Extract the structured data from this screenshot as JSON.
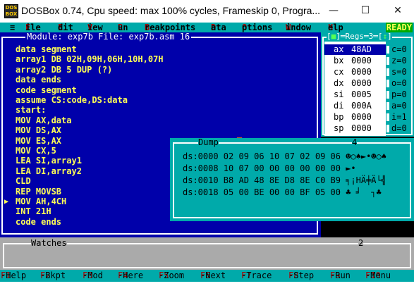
{
  "window": {
    "icon_text": "DOS\nBOX",
    "title": "DOSBox 0.74, Cpu speed: max 100% cycles, Frameskip  0, Progra...",
    "minimize": "—",
    "maximize": "☐",
    "close": "✕"
  },
  "menu": {
    "system": "≡",
    "items": [
      {
        "hot": "F",
        "rest": "ile"
      },
      {
        "hot": "E",
        "rest": "dit"
      },
      {
        "hot": "V",
        "rest": "iew"
      },
      {
        "hot": "R",
        "rest": "un"
      },
      {
        "hot": "B",
        "rest": "reakpoints"
      },
      {
        "hot": "D",
        "rest": "ata"
      },
      {
        "hot": "O",
        "rest": "ptions"
      },
      {
        "hot": "W",
        "rest": "indow"
      },
      {
        "hot": "H",
        "rest": "elp"
      }
    ],
    "status": "READY"
  },
  "module": {
    "title": "Module: exp7b File: exp7b.asm 16",
    "lines": [
      "data segment",
      "array1 DB 02H,09H,06H,10H,07H",
      "array2 DB 5 DUP (?)",
      "data ends",
      "code segment",
      "assume CS:code,DS:data",
      "start:",
      "MOV AX,data",
      "MOV DS,AX",
      "MOV ES,AX",
      "MOV CX,5",
      "LEA SI,array1",
      "LEA DI,array2",
      "CLD",
      "REP MOVSB",
      "MOV AH,4CH",
      "INT 21H",
      "code ends"
    ],
    "current_marker": "▶"
  },
  "regs": {
    "title_left": "[",
    "title_dot": "■",
    "title_mid": "]═Regs═3═[",
    "title_arrow": "↕",
    "title_right": "]",
    "rows": [
      {
        "name": "ax",
        "value": "48AD"
      },
      {
        "name": "bx",
        "value": "0000"
      },
      {
        "name": "cx",
        "value": "0000"
      },
      {
        "name": "dx",
        "value": "0000"
      },
      {
        "name": "si",
        "value": "0005"
      },
      {
        "name": "di",
        "value": "000A"
      },
      {
        "name": "bp",
        "value": "0000"
      },
      {
        "name": "sp",
        "value": "0000"
      }
    ],
    "flags": [
      "c=0",
      "z=0",
      "s=0",
      "o=0",
      "p=0",
      "a=0",
      "i=1",
      "d=0"
    ]
  },
  "dump": {
    "title": "Dump",
    "number": "4",
    "lines": [
      "ds:0000 02 09 06 10 07 02 09 06 ☻○♠►•☻○♠",
      "ds:0008 10 07 00 00 00 00 00 00 ►•      ",
      "ds:0010 B8 AD 48 8E D8 8E C0 B9 ╕¡HÄ╪Ä└╣",
      "ds:0018 05 00 BE 00 00 BF 05 00 ♣ ╛  ┐♣ "
    ]
  },
  "watches": {
    "title": "Watches",
    "number": "2"
  },
  "fkeys": [
    {
      "key": "F1",
      "label": "-Help"
    },
    {
      "key": "F2",
      "label": "-Bkpt"
    },
    {
      "key": "F3",
      "label": "-Mod"
    },
    {
      "key": "F4",
      "label": "-Here"
    },
    {
      "key": "F5",
      "label": "-Zoom"
    },
    {
      "key": "F6",
      "label": "-Next"
    },
    {
      "key": "F7",
      "label": "-Trace"
    },
    {
      "key": "F8",
      "label": "-Step"
    },
    {
      "key": "F9",
      "label": "-Run"
    },
    {
      "key": "F10",
      "label": "-Menu"
    }
  ]
}
